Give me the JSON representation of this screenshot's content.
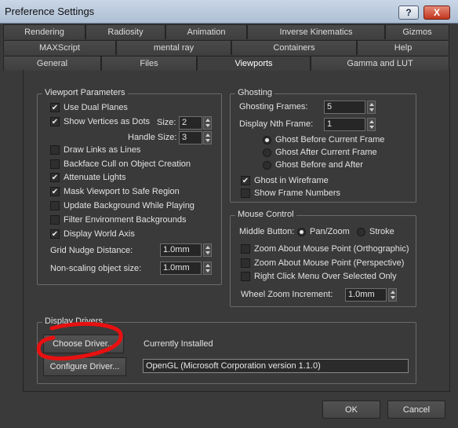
{
  "window": {
    "title": "Preference Settings",
    "help_label": "?",
    "close_label": "X"
  },
  "tabs": {
    "row1": [
      "Rendering",
      "Radiosity",
      "Animation",
      "Inverse Kinematics",
      "Gizmos"
    ],
    "row2": [
      "MAXScript",
      "mental ray",
      "Containers",
      "Help"
    ],
    "row3": [
      "General",
      "Files",
      "Viewports",
      "Gamma and LUT"
    ],
    "active": "Viewports"
  },
  "viewport_parameters": {
    "legend": "Viewport Parameters",
    "use_dual_planes": {
      "label": "Use Dual Planes",
      "checked": true
    },
    "show_vertices_as_dots": {
      "label": "Show Vertices as Dots",
      "checked": true
    },
    "size_label": "Size:",
    "size_value": "2",
    "handle_size_label": "Handle Size:",
    "handle_size_value": "3",
    "draw_links_as_lines": {
      "label": "Draw Links as Lines",
      "checked": false
    },
    "backface_cull": {
      "label": "Backface Cull on Object Creation",
      "checked": false
    },
    "attenuate_lights": {
      "label": "Attenuate Lights",
      "checked": true
    },
    "mask_viewport": {
      "label": "Mask Viewport to Safe Region",
      "checked": true
    },
    "update_background": {
      "label": "Update Background While Playing",
      "checked": false
    },
    "filter_env_backgrounds": {
      "label": "Filter Environment Backgrounds",
      "checked": false
    },
    "display_world_axis": {
      "label": "Display World Axis",
      "checked": true
    },
    "grid_nudge_label": "Grid Nudge Distance:",
    "grid_nudge_value": "1.0mm",
    "non_scaling_label": "Non-scaling object size:",
    "non_scaling_value": "1.0mm"
  },
  "ghosting": {
    "legend": "Ghosting",
    "frames_label": "Ghosting Frames:",
    "frames_value": "5",
    "nth_label": "Display Nth Frame:",
    "nth_value": "1",
    "radio_before": "Ghost Before Current Frame",
    "radio_after": "Ghost After Current Frame",
    "radio_both": "Ghost Before and After",
    "selected": "before",
    "ghost_in_wireframe": {
      "label": "Ghost in Wireframe",
      "checked": true
    },
    "show_frame_numbers": {
      "label": "Show Frame Numbers",
      "checked": false
    }
  },
  "mouse_control": {
    "legend": "Mouse Control",
    "middle_button_label": "Middle Button:",
    "pan_zoom_label": "Pan/Zoom",
    "stroke_label": "Stroke",
    "selected": "pan_zoom",
    "zoom_ortho": {
      "label": "Zoom About Mouse Point (Orthographic)",
      "checked": false
    },
    "zoom_persp": {
      "label": "Zoom About Mouse Point (Perspective)",
      "checked": false
    },
    "right_click_menu": {
      "label": "Right Click Menu Over Selected Only",
      "checked": false
    },
    "wheel_zoom_label": "Wheel Zoom Increment:",
    "wheel_zoom_value": "1.0mm"
  },
  "display_drivers": {
    "legend": "Display Drivers",
    "choose_driver_label": "Choose Driver...",
    "configure_driver_label": "Configure Driver...",
    "currently_installed_label": "Currently Installed",
    "driver_value": "OpenGL (Microsoft Corporation version 1.1.0)"
  },
  "footer": {
    "ok_label": "OK",
    "cancel_label": "Cancel"
  },
  "colors": {
    "background": "#3a3a3a",
    "annotation": "#e81010",
    "titlebar": "#c9d6e6",
    "close": "#c2361e"
  }
}
